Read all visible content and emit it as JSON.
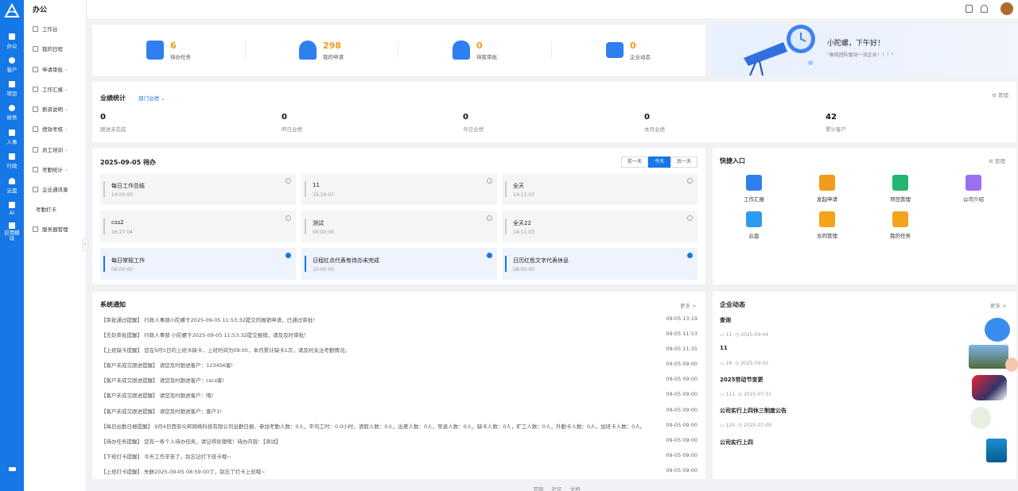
{
  "rail": {
    "items": [
      {
        "label": "办公"
      },
      {
        "label": "客户"
      },
      {
        "label": "项目"
      },
      {
        "label": "财务"
      },
      {
        "label": "人事"
      },
      {
        "label": "行政"
      },
      {
        "label": "云盘"
      },
      {
        "label": "AI"
      },
      {
        "label": "应用模块"
      }
    ]
  },
  "sidebar": {
    "title": "办公",
    "items": [
      {
        "label": "工作台",
        "icon": "workbench-icon"
      },
      {
        "label": "我的日程",
        "icon": "calendar-icon"
      },
      {
        "label": "申请审批",
        "icon": "approval-icon",
        "expandable": true
      },
      {
        "label": "工作汇报",
        "icon": "report-icon",
        "expandable": true
      },
      {
        "label": "薪资说明",
        "icon": "salary-icon",
        "expandable": true
      },
      {
        "label": "绩效考核",
        "icon": "performance-icon",
        "expandable": true
      },
      {
        "label": "员工培训",
        "icon": "training-icon",
        "expandable": true
      },
      {
        "label": "考勤统计",
        "icon": "attendance-icon",
        "expandable": true
      },
      {
        "label": "企业通讯录",
        "icon": "contacts-icon"
      },
      {
        "label": "考勤打卡",
        "icon": ""
      },
      {
        "label": "服务器管理",
        "icon": "server-icon"
      }
    ]
  },
  "stats": [
    {
      "value": "6",
      "label": "待办任务",
      "color": "#2f7ff0"
    },
    {
      "value": "298",
      "label": "我的申请",
      "color": "#2f7ff0"
    },
    {
      "value": "0",
      "label": "待我审批",
      "color": "#2f7ff0"
    },
    {
      "value": "0",
      "label": "企业动态",
      "color": "#2f7ff0"
    }
  ],
  "banner": {
    "greeting": "小陀螺，下午好！",
    "slogan": "\"高效团队驱动一流企业！！！\""
  },
  "performance": {
    "title": "业绩统计",
    "filter": "部门业绩",
    "manage": "管理",
    "items": [
      {
        "value": "0",
        "label": "跟进未完成"
      },
      {
        "value": "0",
        "label": "昨日业绩"
      },
      {
        "value": "0",
        "label": "今日业绩"
      },
      {
        "value": "0",
        "label": "本月业绩"
      },
      {
        "value": "42",
        "label": "累计客户"
      }
    ]
  },
  "todos": {
    "title": "2025-09-05 待办",
    "nav": [
      "前一天",
      "今天",
      "后一天"
    ],
    "items": [
      {
        "title": "每日工作总结",
        "time": "14:00:00",
        "done": false
      },
      {
        "title": "11",
        "time": "15:29:07",
        "done": false
      },
      {
        "title": "全天",
        "time": "14:11:03",
        "done": false
      },
      {
        "title": "css2",
        "time": "16:27:04",
        "done": false
      },
      {
        "title": "测试",
        "time": "00:00:00",
        "done": false
      },
      {
        "title": "全天22",
        "time": "14:11:03",
        "done": false
      },
      {
        "title": "每日常规工作",
        "time": "08:00:00",
        "done": true
      },
      {
        "title": "日程红点代表有待办未完成",
        "time": "10:00:00",
        "done": true
      },
      {
        "title": "日历红色文字代表休息",
        "time": "08:00:00",
        "done": true
      }
    ]
  },
  "quick": {
    "title": "快捷入口",
    "manage": "管理",
    "items": [
      {
        "label": "工作汇报",
        "color": "#2f7ff0"
      },
      {
        "label": "发起申请",
        "color": "#f29b1a"
      },
      {
        "label": "项目管理",
        "color": "#22b573"
      },
      {
        "label": "公司介绍",
        "color": "#9a6ff0"
      },
      {
        "label": "云盘",
        "color": "#2f9bf0"
      },
      {
        "label": "合同管理",
        "color": "#f2a41a"
      },
      {
        "label": "我的任务",
        "color": "#f2a41a"
      }
    ]
  },
  "notices": {
    "title": "系统通知",
    "more": "更多 >",
    "items": [
      {
        "text": "【审批通过提醒】 行政人事部小陀螺于2025-09-05 11:53:32提交的报销申请，已通过审批！",
        "date": "09-05 13:19"
      },
      {
        "text": "【去处审批提醒】 行政人事部 小陀螺于2025-09-05 11:53:32提交报销，请及及时审批！",
        "date": "09-05 11:53"
      },
      {
        "text": "【上班缺卡提醒】 您在9月5日的上班卡缺卡，上班时间为09:00，本月累计缺卡1次，请及时关注考勤情况。",
        "date": "09-05 11:35"
      },
      {
        "text": "【客户未成交跟进提醒】 请您及时跟进客户：123456客!",
        "date": "09-05 09:00"
      },
      {
        "text": "【客户未成交跟进提醒】 请您及时跟进客户：cscs客!",
        "date": "09-05 09:00"
      },
      {
        "text": "【客户未成交跟进提醒】 请您及时跟进客户：哦!",
        "date": "09-05 09:00"
      },
      {
        "text": "【客户未成交跟进提醒】 请您及时跟进客户：客户1!",
        "date": "09-05 09:00"
      },
      {
        "text": "【每日出勤日报提醒】 9月4日西安众邦网络科技有限公司出勤日报，参加考勤人数：0人，平均工时：0.0小时，请假人数：0人，出差人数：0人，早退人数：0人，缺卡人数：0人，旷工人数：0人，外勤卡人数：0人，加班卡人数：0人。",
        "date": "09-05 09:00"
      },
      {
        "text": "【待办任务提醒】 您有一条个人待办任务，请记得处理哦！待办内容：【测试】",
        "date": "09-05 09:00"
      },
      {
        "text": "【下班打卡提醒】 今天工作辛苦了，别忘记打下班卡哦~",
        "date": "09-05 09:00"
      },
      {
        "text": "【上班打卡提醒】 失联2025-09-05 08:59:00了，别忘了打卡上班哦~",
        "date": "09-05 09:00"
      }
    ]
  },
  "news": {
    "title": "企业动态",
    "more": "更多 >",
    "items": [
      {
        "title": "查询",
        "comments": "11",
        "date": "2025-09-04"
      },
      {
        "title": "11",
        "comments": "18",
        "date": "2025-09-03"
      },
      {
        "title": "2025劳动节变更",
        "comments": "111",
        "date": "2025-07-31"
      },
      {
        "title": "公司实行上四休三制度公告",
        "comments": "120",
        "date": "2025-07-09"
      },
      {
        "title": "公司实行上四",
        "comments": "",
        "date": ""
      }
    ]
  },
  "footer": [
    "官网",
    "社区",
    "文档"
  ]
}
